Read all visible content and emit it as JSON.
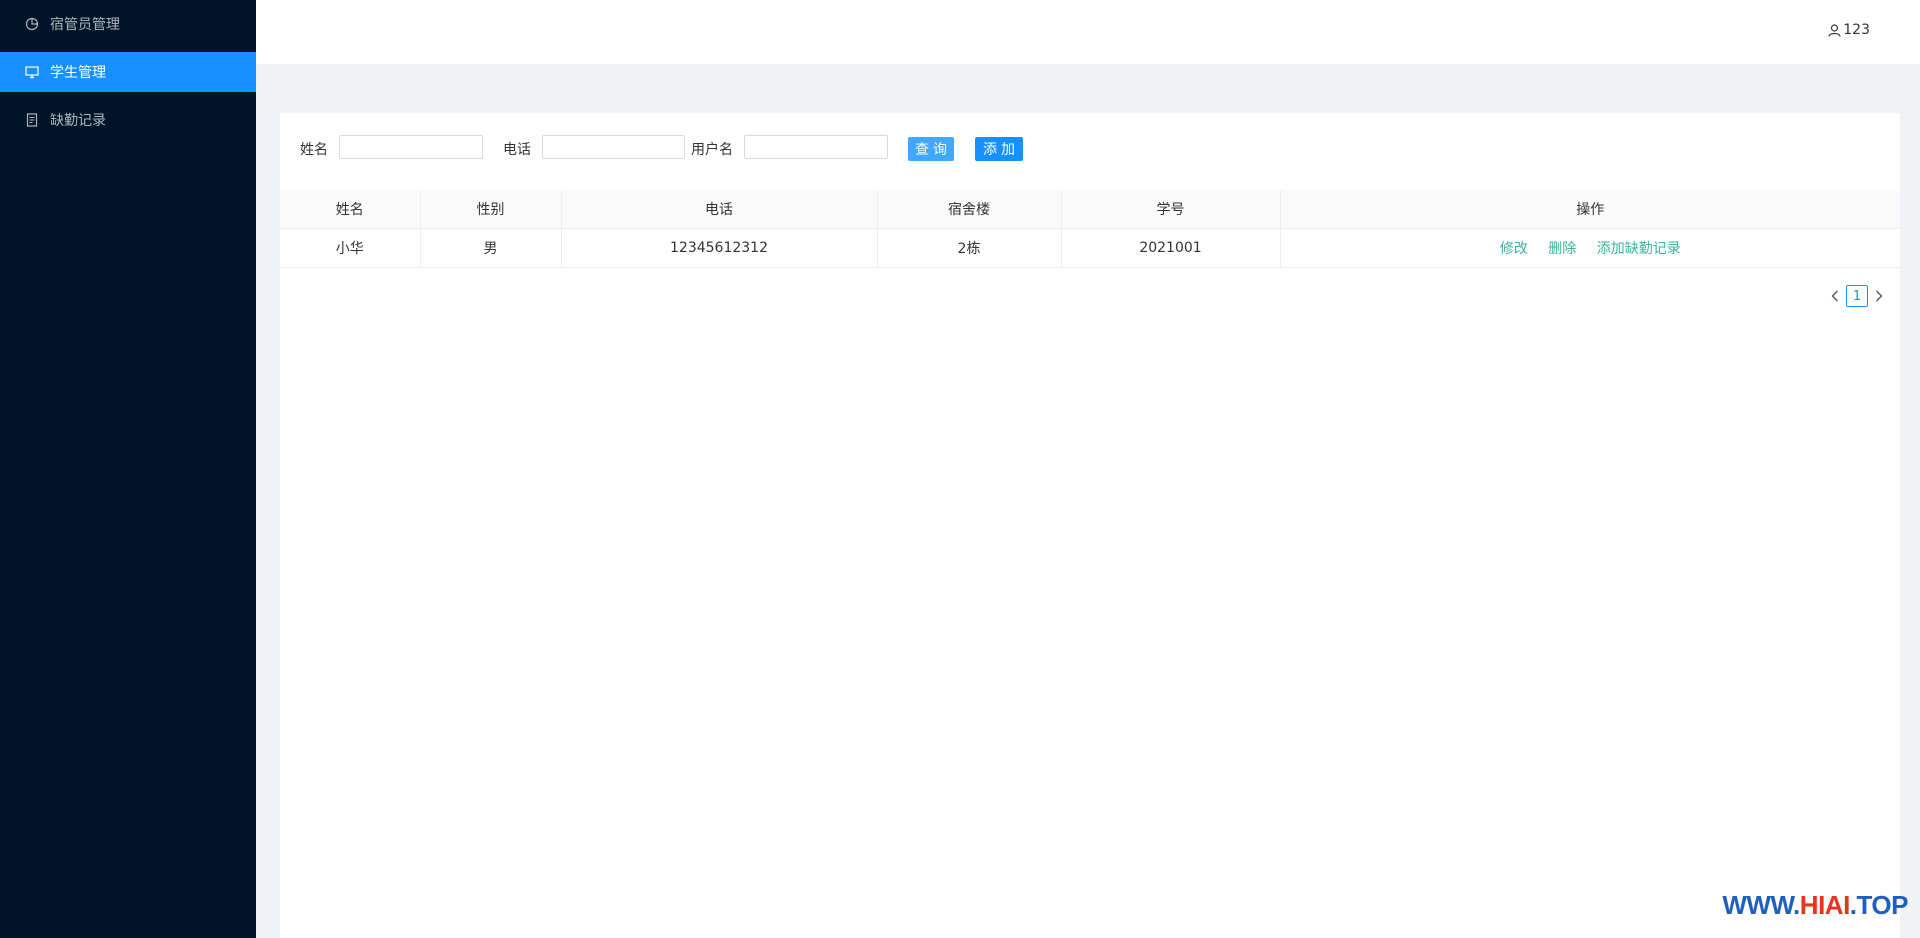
{
  "sidebar": {
    "items": [
      {
        "label": "宿管员管理",
        "icon": "pie-chart-icon",
        "active": false
      },
      {
        "label": "学生管理",
        "icon": "monitor-icon",
        "active": true
      },
      {
        "label": "缺勤记录",
        "icon": "document-icon",
        "active": false
      }
    ]
  },
  "header": {
    "user": {
      "icon": "user-icon",
      "name": "123"
    }
  },
  "search": {
    "name_label": "姓名",
    "phone_label": "电话",
    "username_label": "用户名",
    "name_value": "",
    "phone_value": "",
    "username_value": "",
    "search_button": "查询",
    "add_button": "添加"
  },
  "table": {
    "headers": [
      "姓名",
      "性别",
      "电话",
      "宿舍楼",
      "学号",
      "操作"
    ],
    "rows": [
      {
        "name": "小华",
        "gender": "男",
        "phone": "12345612312",
        "building": "2栋",
        "student_id": "2021001",
        "actions": [
          "修改",
          "删除",
          "添加缺勤记录"
        ]
      }
    ]
  },
  "pagination": {
    "current": "1",
    "prev_icon": "chevron-left-icon",
    "next_icon": "chevron-right-icon"
  },
  "watermark": {
    "part1": "WWW.",
    "part2": "HIAI",
    "part3": ".TOP"
  },
  "colors": {
    "sidebar": "#001529",
    "active": "#1890ff",
    "link": "#40b0a0"
  }
}
